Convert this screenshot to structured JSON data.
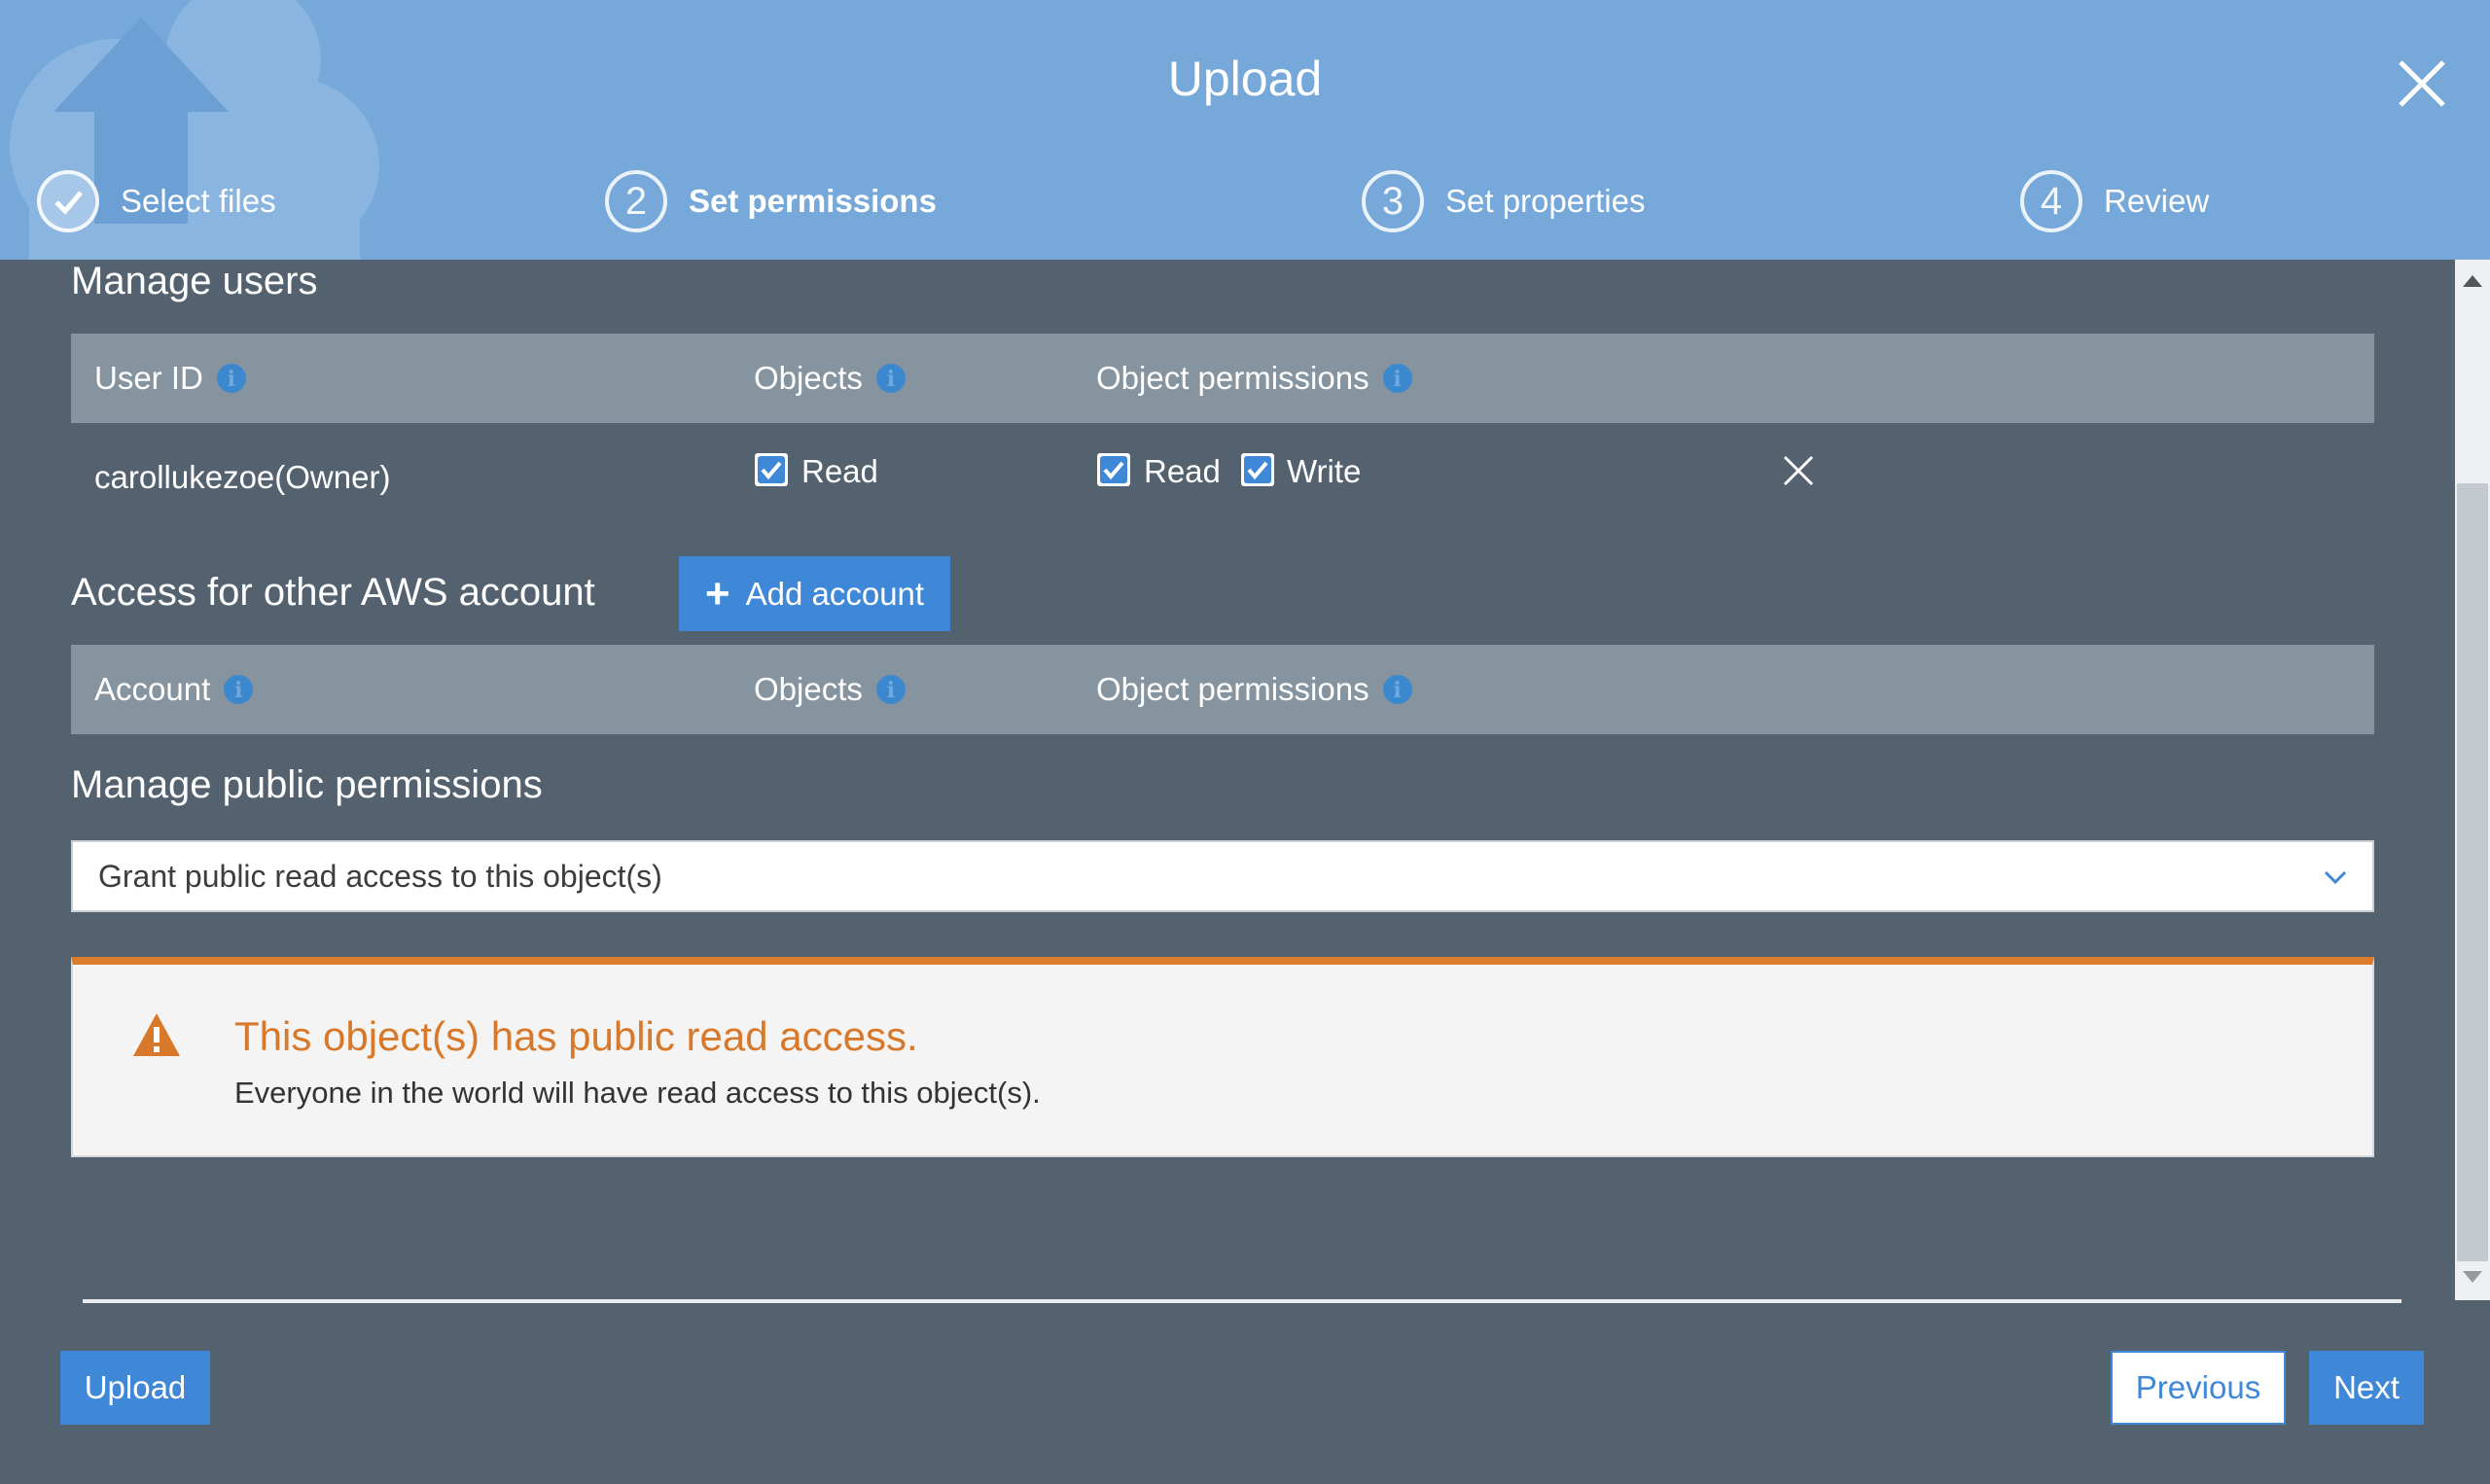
{
  "dialog": {
    "title": "Upload",
    "steps": [
      {
        "number": "1",
        "label": "Select files",
        "state": "completed"
      },
      {
        "number": "2",
        "label": "Set permissions",
        "state": "active"
      },
      {
        "number": "3",
        "label": "Set properties",
        "state": "pending"
      },
      {
        "number": "4",
        "label": "Review",
        "state": "pending"
      }
    ]
  },
  "manage_users": {
    "title": "Manage users",
    "columns": [
      "User ID",
      "Objects",
      "Object permissions"
    ],
    "rows": [
      {
        "user_id": "carollukezoe(Owner)",
        "objects_read_label": "Read",
        "objects_read_checked": true,
        "perm_read_label": "Read",
        "perm_read_checked": true,
        "perm_write_label": "Write",
        "perm_write_checked": true
      }
    ]
  },
  "other_accounts": {
    "title": "Access for other AWS account",
    "add_button_label": "Add account",
    "columns": [
      "Account",
      "Objects",
      "Object permissions"
    ]
  },
  "public_permissions": {
    "title": "Manage public permissions",
    "selected_option": "Grant public read access to this object(s)"
  },
  "alert": {
    "title": "This object(s) has public read access.",
    "message": "Everyone in the world will have read access to this object(s)."
  },
  "footer": {
    "upload_label": "Upload",
    "previous_label": "Previous",
    "next_label": "Next"
  },
  "colors": {
    "header_bg": "#76a8d9",
    "content_bg": "#546270",
    "primary_button": "#3f88d8",
    "warning": "#d8782a"
  }
}
